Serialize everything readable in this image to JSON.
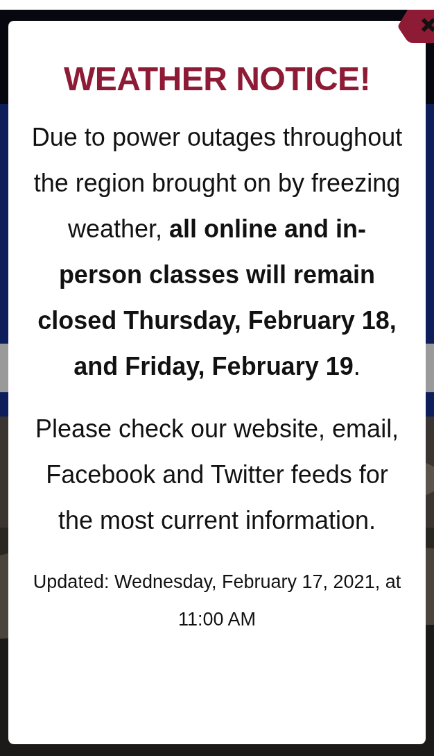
{
  "modal": {
    "title": "WEATHER NOTICE!",
    "paragraphs": [
      "Due to power outages throughout the region brought on by freezing weather, **all online and in-person classes will remain closed Thursday, February 18, and Friday, February 19**.",
      "Please check our website, email, Facebook and Twitter feeds for the most current information."
    ],
    "updated": "Updated: Wednesday, February 17, 2021, at 11:00 AM"
  }
}
